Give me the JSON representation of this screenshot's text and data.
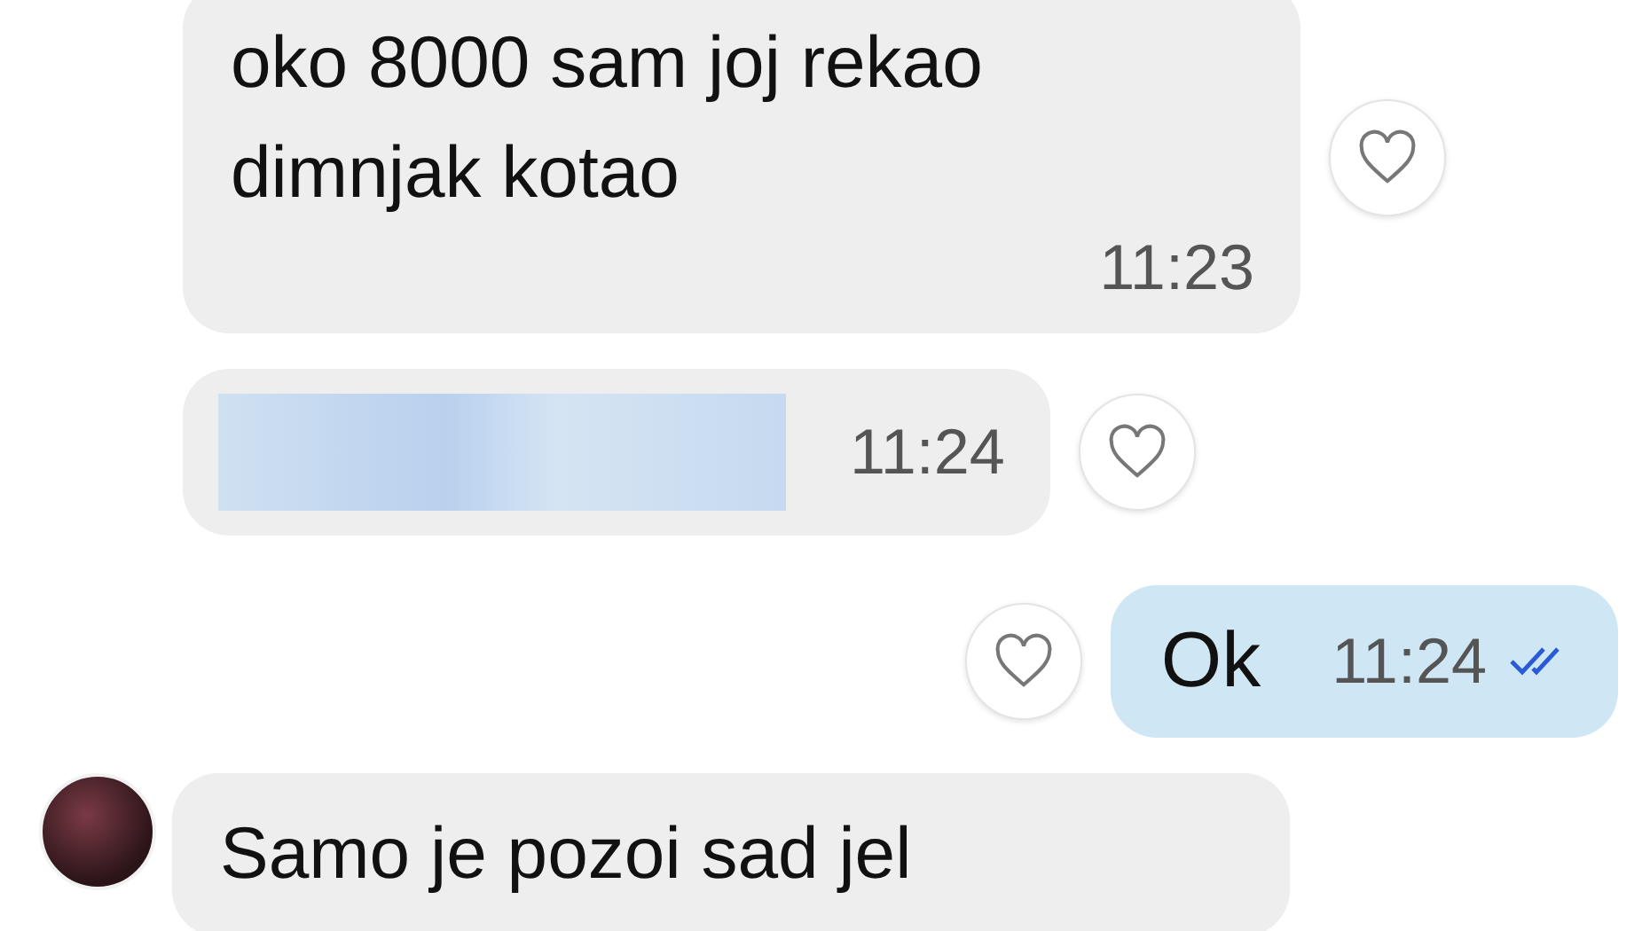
{
  "messages": [
    {
      "kind": "incoming",
      "text": "oko 8000 sam joj rekao dimnjak kotao",
      "time": "11:23"
    },
    {
      "kind": "hidden",
      "time": "11:24"
    },
    {
      "kind": "outgoing",
      "text": "Ok",
      "time": "11:24",
      "read": true
    },
    {
      "kind": "incoming",
      "text": "Samo je pozoi sad jel",
      "avatar": true
    }
  ]
}
